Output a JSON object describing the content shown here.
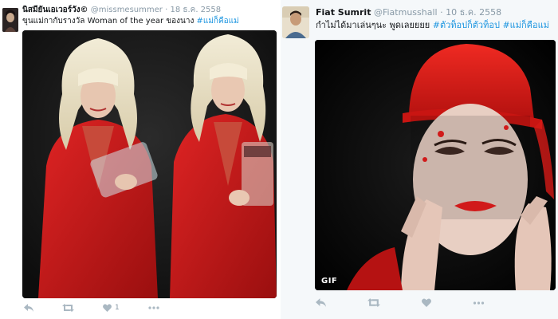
{
  "left_tweet": {
    "display_name": "นิสมียันเอเวอร์วัง©",
    "handle": "@missmesummer",
    "dot": "·",
    "date": "18 ธ.ค. 2558",
    "text": "ขุนแม่กากับรางวัล Woman of the year ของนาง ",
    "hashtag": "#แม่ก็คือแม่",
    "actions": {
      "reply_icon": "reply-icon",
      "retweet_icon": "retweet-icon",
      "like_icon": "heart-icon",
      "like_count": "1",
      "more_icon": "more-icon"
    }
  },
  "right_tweet": {
    "display_name": "Fiat Sumrit",
    "handle": "@Fiatmusshall",
    "dot": "·",
    "date": "10 ธ.ค. 2558",
    "text": "กำไม่ได้มาเล่นๆนะ พูดเลยยยย ",
    "hashtag_1": "#ตัวท็อปก็ตัวท็อป",
    "hashtag_2": "#แม่ก็คือแม่",
    "media_badge": "GIF",
    "actions": {
      "reply_icon": "reply-icon",
      "retweet_icon": "retweet-icon",
      "like_icon": "heart-icon",
      "more_icon": "more-icon"
    }
  },
  "colors": {
    "hashtag": "#1b95e0",
    "action_gray": "#aab8c2",
    "outfit_red": "#d11a1a"
  }
}
